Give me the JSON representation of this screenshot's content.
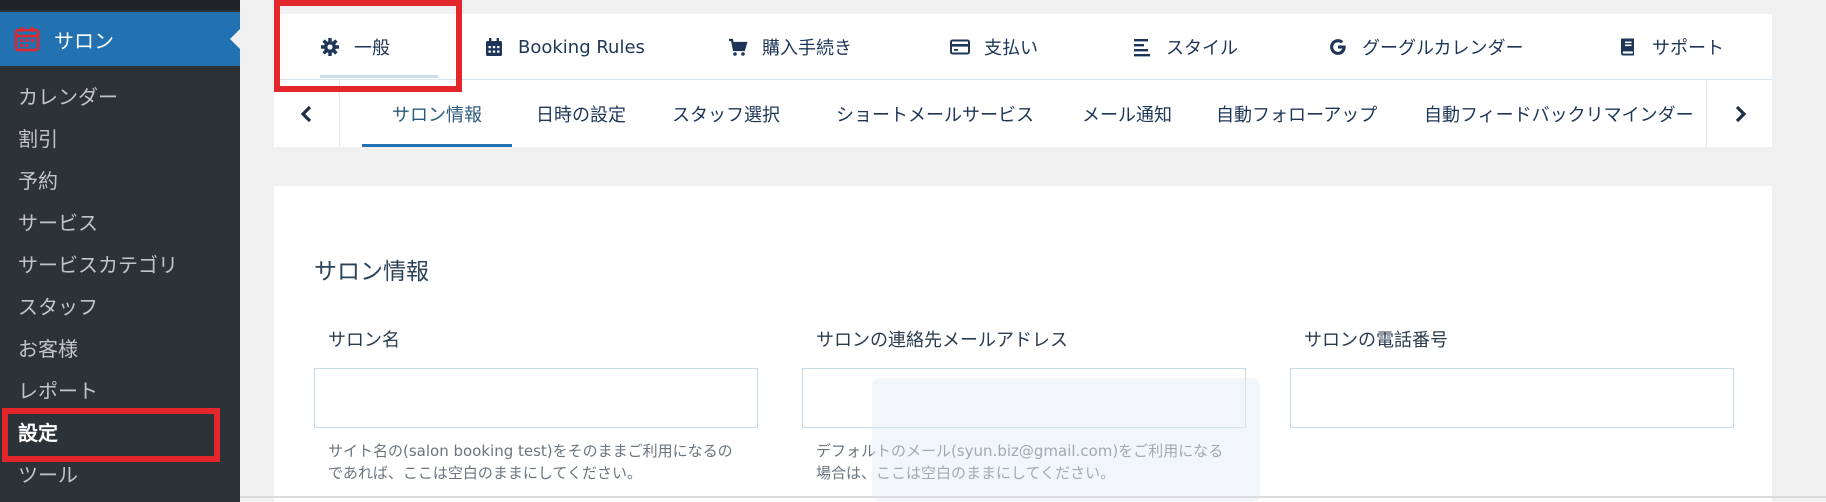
{
  "sidebar": {
    "active_menu": {
      "label": "サロン",
      "icon": "calendar-icon"
    },
    "items": [
      {
        "label": "カレンダー",
        "current": false
      },
      {
        "label": "割引",
        "current": false
      },
      {
        "label": "予約",
        "current": false
      },
      {
        "label": "サービス",
        "current": false
      },
      {
        "label": "サービスカテゴリ",
        "current": false
      },
      {
        "label": "スタッフ",
        "current": false
      },
      {
        "label": "お客様",
        "current": false
      },
      {
        "label": "レポート",
        "current": false
      },
      {
        "label": "設定",
        "current": true
      },
      {
        "label": "ツール",
        "current": false
      }
    ]
  },
  "main_tabs": [
    {
      "label": "一般",
      "icon": "gear-icon",
      "active": true
    },
    {
      "label": "Booking Rules",
      "icon": "calendar-icon",
      "active": false
    },
    {
      "label": "購入手続き",
      "icon": "cart-icon",
      "active": false
    },
    {
      "label": "支払い",
      "icon": "credit-card-icon",
      "active": false
    },
    {
      "label": "スタイル",
      "icon": "align-left-icon",
      "active": false
    },
    {
      "label": "グーグルカレンダー",
      "icon": "google-icon",
      "active": false
    },
    {
      "label": "サポート",
      "icon": "book-icon",
      "active": false
    }
  ],
  "sub_tabs": [
    {
      "label": "サロン情報",
      "active": true
    },
    {
      "label": "日時の設定",
      "active": false
    },
    {
      "label": "スタッフ選択",
      "active": false
    },
    {
      "label": "ショートメールサービス",
      "active": false
    },
    {
      "label": "メール通知",
      "active": false
    },
    {
      "label": "自動フォローアップ",
      "active": false
    },
    {
      "label": "自動フィードバックリマインダー",
      "active": false
    }
  ],
  "content": {
    "section_title": "サロン情報",
    "fields": [
      {
        "label": "サロン名",
        "value": "",
        "help": "サイト名の(salon booking test)をそのままご利用になるのであれば、ここは空白のままにしてください。"
      },
      {
        "label": "サロンの連絡先メールアドレス",
        "value": "",
        "help": "デフォルトのメール(syun.biz@gmail.com)をご利用になる場合は、ここは空白のままにしてください。"
      },
      {
        "label": "サロンの電話番号",
        "value": "",
        "help": ""
      }
    ]
  },
  "colors": {
    "sidebar_bg": "#2c3338",
    "sidebar_active": "#2271b1",
    "highlight_red": "#e2262b",
    "tab_text": "#1d3557"
  }
}
